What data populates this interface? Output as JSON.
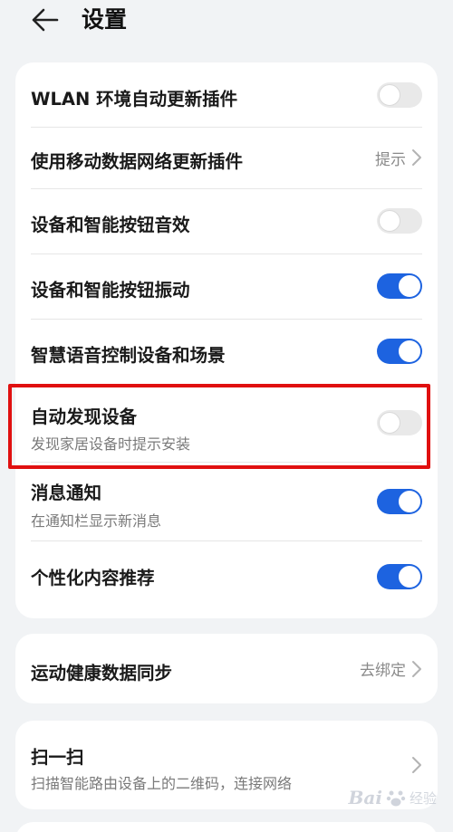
{
  "header": {
    "title": "设置"
  },
  "card1": [
    {
      "title": "WLAN 环境自动更新插件",
      "control": "toggle",
      "on": false
    },
    {
      "title": "使用移动数据网络更新插件",
      "control": "link",
      "hint": "提示"
    },
    {
      "title": "设备和智能按钮音效",
      "control": "toggle",
      "on": false
    },
    {
      "title": "设备和智能按钮振动",
      "control": "toggle",
      "on": true
    },
    {
      "title": "智慧语音控制设备和场景",
      "control": "toggle",
      "on": true
    },
    {
      "title": "自动发现设备",
      "subtitle": "发现家居设备时提示安装",
      "control": "toggle",
      "on": false
    },
    {
      "title": "消息通知",
      "subtitle": "在通知栏显示新消息",
      "control": "toggle",
      "on": true
    },
    {
      "title": "个性化内容推荐",
      "control": "toggle",
      "on": true
    }
  ],
  "card2": {
    "title": "运动健康数据同步",
    "hint": "去绑定"
  },
  "card3": {
    "title": "扫一扫",
    "subtitle": "扫描智能路由设备上的二维码，连接网络"
  },
  "watermark": {
    "text": "Bai",
    "sub": "经验"
  },
  "colors": {
    "accent": "#1d63e0",
    "highlight": "#e01010",
    "background": "#f1f3f5"
  },
  "icons": {
    "back": "arrow-left-icon",
    "chevron": "chevron-right-icon"
  }
}
